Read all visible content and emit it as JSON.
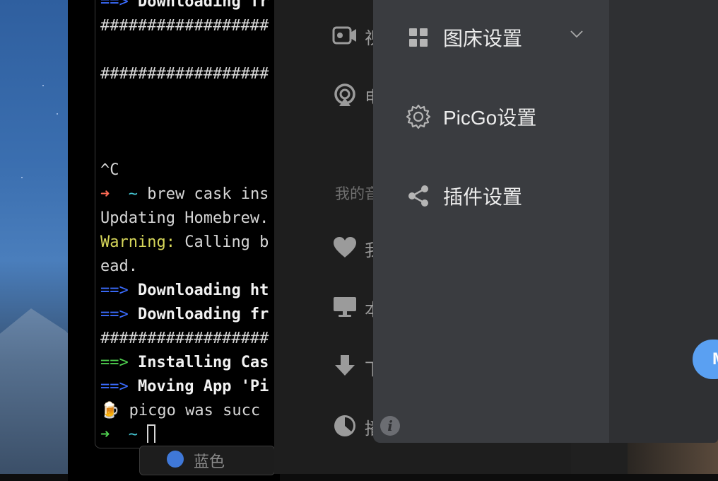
{
  "terminal": {
    "lines": [
      {
        "prefix": "==>",
        "text": " Downloading fr"
      },
      {
        "text": "##################"
      },
      {
        "text": ""
      },
      {
        "text": "##################"
      },
      {
        "text": ""
      },
      {
        "text": ""
      },
      {
        "text": ""
      },
      {
        "text": "^C"
      },
      {
        "prefix": "➜",
        "tilde": "~",
        "text": " brew cask ins"
      },
      {
        "text": "Updating Homebrew."
      },
      {
        "prefix": "Warning:",
        "text": " Calling b"
      },
      {
        "text": "ead."
      },
      {
        "prefix": "==>",
        "text": " Downloading ht"
      },
      {
        "prefix": "==>",
        "text": " Downloading fr"
      },
      {
        "text": "##################"
      },
      {
        "prefix": "==>",
        "text": " Installing Cas"
      },
      {
        "prefix": "==>",
        "text": " Moving App 'Pi"
      },
      {
        "prefix": "🍺",
        "text": " picgo was succ"
      },
      {
        "prefix": "➜",
        "tilde": "~",
        "text": ""
      }
    ],
    "dock_tab_label": "蓝色"
  },
  "back_sidebar": {
    "items": [
      {
        "icon": "video-icon",
        "label": "视"
      },
      {
        "icon": "airplay-icon",
        "label": "电"
      },
      {
        "icon": "heart-icon",
        "label": "我"
      },
      {
        "icon": "monitor-icon",
        "label": "本"
      },
      {
        "icon": "download-icon",
        "label": "下"
      },
      {
        "icon": "clock-icon",
        "label": "播"
      }
    ],
    "section_heading": "我的音"
  },
  "settings_panel": {
    "items": [
      {
        "icon": "grid-icon",
        "label": "图床设置",
        "expandable": true
      },
      {
        "icon": "gear-icon",
        "label": "PicGo设置"
      },
      {
        "icon": "share-icon",
        "label": "插件设置"
      }
    ],
    "info_glyph": "i"
  },
  "floating_button": {
    "label": "M"
  },
  "colors": {
    "panel_bg": "#3a3c40",
    "accent_blue": "#5aa0f2",
    "terminal_prompt_green": "#4fd04f",
    "terminal_arrow_blue": "#3b6cff"
  }
}
